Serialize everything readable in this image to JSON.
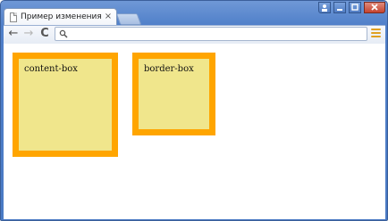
{
  "browser": {
    "tab": {
      "title": "Пример изменения модели",
      "close_label": "×"
    },
    "window_controls": {
      "user_icon": "user-icon",
      "min_icon": "minimize-icon",
      "max_icon": "maximize-icon",
      "close_icon": "close-icon"
    },
    "toolbar": {
      "back_icon": "←",
      "forward_icon": "→",
      "reload_icon": "C",
      "address_value": "",
      "address_placeholder": ""
    }
  },
  "page": {
    "boxes": [
      {
        "label": "content-box"
      },
      {
        "label": "border-box"
      }
    ]
  },
  "colors": {
    "box_border": "#ffa500",
    "box_fill": "#f0e68c",
    "chrome_frame": "#4f7fc9"
  }
}
